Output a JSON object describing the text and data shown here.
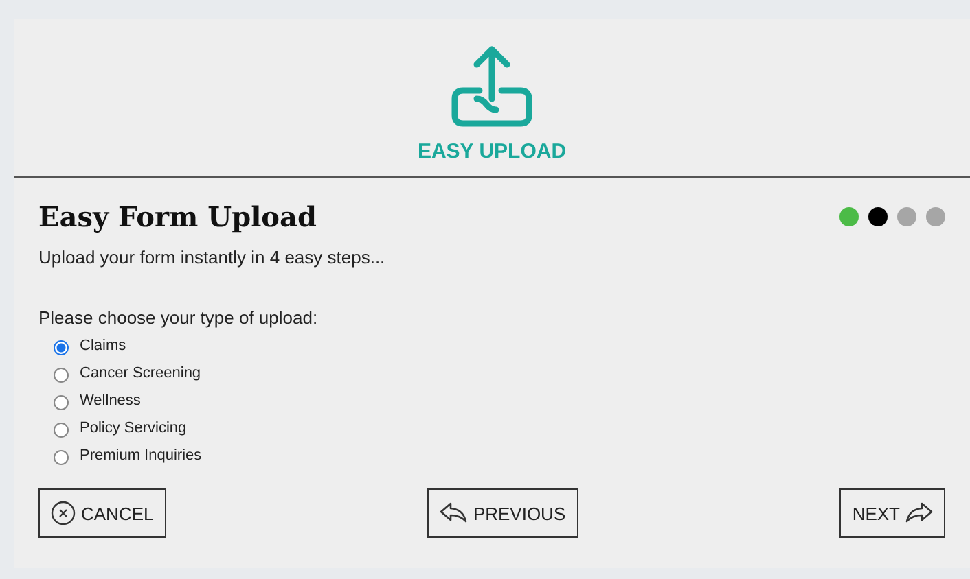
{
  "header": {
    "title": "EASY UPLOAD"
  },
  "form": {
    "title": "Easy Form Upload",
    "subtitle": "Upload your form instantly in 4 easy steps...",
    "question": "Please choose your type of upload:"
  },
  "steps": [
    {
      "color": "#4cbb47"
    },
    {
      "color": "#000000"
    },
    {
      "color": "#a6a6a6"
    },
    {
      "color": "#a6a6a6"
    }
  ],
  "options": [
    {
      "label": "Claims",
      "selected": true
    },
    {
      "label": "Cancer Screening",
      "selected": false
    },
    {
      "label": "Wellness",
      "selected": false
    },
    {
      "label": "Policy Servicing",
      "selected": false
    },
    {
      "label": "Premium Inquiries",
      "selected": false
    }
  ],
  "buttons": [
    {
      "kind": "cancel",
      "label": "CANCEL"
    },
    {
      "kind": "previous",
      "label": "PREVIOUS"
    },
    {
      "kind": "next",
      "label": "NEXT"
    }
  ]
}
